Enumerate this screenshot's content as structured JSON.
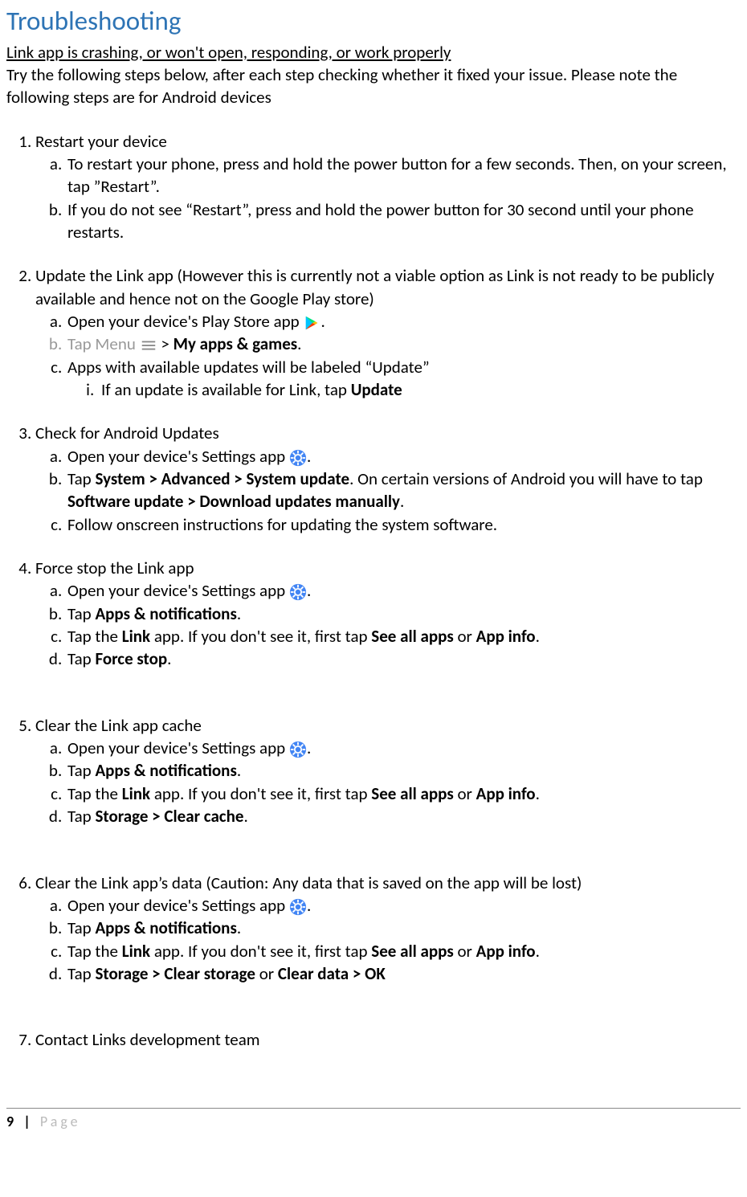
{
  "heading": "Troubleshooting",
  "subtitle": "Link app is crashing, or won't open, responding, or work properly",
  "intro": "Try the following steps below, after each step checking whether it fixed your issue. Please note the following steps are for Android devices",
  "steps": {
    "s1": {
      "title": "Restart your device",
      "a": "To restart your phone, press and hold the power button for a few seconds. Then, on your screen, tap ”Restart”.",
      "b": "If you do not see “Restart”, press and hold the power button for 30 second until your phone restarts."
    },
    "s2": {
      "title": "Update the Link app (However this is currently not a viable option as Link is not ready to be publicly available and hence not on the Google Play store)",
      "a_pre": "Open your device's Play Store app ",
      "a_post": ".",
      "b_pre": "Tap Menu ",
      "b_mid": " > ",
      "b_bold": "My apps & games",
      "b_post": ".",
      "c": "Apps with available updates will be labeled “Update”",
      "c_i_pre": "If an update is available for Link, tap ",
      "c_i_bold": "Update"
    },
    "s3": {
      "title": "Check for Android Updates",
      "a_pre": "Open your device's Settings app ",
      "a_post": ".",
      "b_pre": "Tap ",
      "b_b1": "System > Advanced > System update",
      "b_mid": ". On certain versions of Android you will have to tap ",
      "b_b2": "Software update > Download updates manually",
      "b_post": ".",
      "c": "Follow onscreen instructions for updating the system software."
    },
    "s4": {
      "title": "Force stop the Link app",
      "a_pre": "Open your device's Settings app ",
      "a_post": ".",
      "b_pre": "Tap ",
      "b_b1": "Apps & notifications",
      "b_post": ".",
      "c_pre": "Tap the ",
      "c_b1": "Link",
      "c_mid": " app. If you don't see it, first tap ",
      "c_b2": "See all apps",
      "c_or": " or ",
      "c_b3": "App info",
      "c_post": ".",
      "d_pre": "Tap ",
      "d_b1": "Force stop",
      "d_post": "."
    },
    "s5": {
      "title": "Clear the Link app cache",
      "a_pre": "Open your device's Settings app ",
      "a_post": ".",
      "b_pre": "Tap ",
      "b_b1": "Apps & notifications",
      "b_post": ".",
      "c_pre": "Tap the ",
      "c_b1": "Link",
      "c_mid": " app. If you don't see it, first tap ",
      "c_b2": "See all apps",
      "c_or": " or ",
      "c_b3": "App info",
      "c_post": ".",
      "d_pre": "Tap ",
      "d_b1": "Storage > Clear cache",
      "d_post": "."
    },
    "s6": {
      "title": "Clear the Link app’s data (Caution: Any data that is saved on the app will be lost)",
      "a_pre": "Open your device's Settings app ",
      "a_post": ".",
      "b_pre": "Tap ",
      "b_b1": "Apps & notifications",
      "b_post": ".",
      "c_pre": "Tap the ",
      "c_b1": "Link",
      "c_mid": " app. If you don't see it, first tap ",
      "c_b2": "See all apps",
      "c_or": " or ",
      "c_b3": "App info",
      "c_post": ".",
      "d_pre": "Tap ",
      "d_b1": "Storage > Clear storage",
      "d_or": " or ",
      "d_b2": "Clear data > OK"
    },
    "s7": {
      "title": "Contact Links development team"
    }
  },
  "footer": {
    "page_number": "9",
    "pipe": " | ",
    "page_word": "Page"
  }
}
